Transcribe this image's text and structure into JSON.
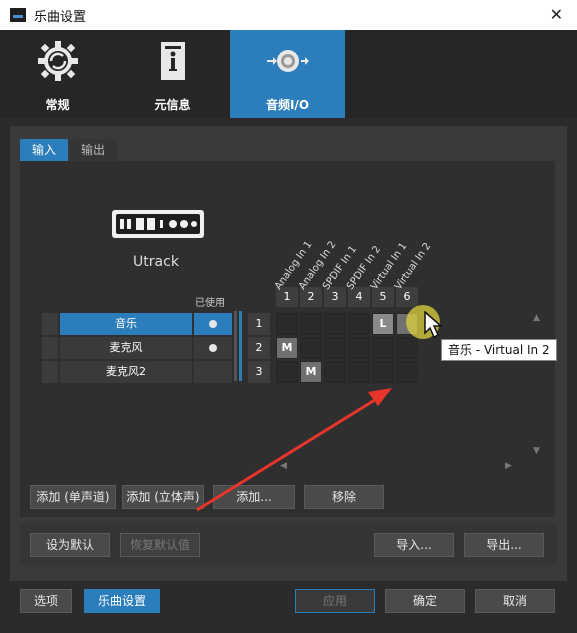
{
  "window": {
    "title": "乐曲设置",
    "close_glyph": "✕"
  },
  "categories": [
    {
      "label": "常规",
      "icon": "gear-refresh-icon",
      "active": false
    },
    {
      "label": "元信息",
      "icon": "info-document-icon",
      "active": false
    },
    {
      "label": "音频I/O",
      "icon": "speaker-io-icon",
      "active": true
    }
  ],
  "subtabs": [
    {
      "label": "输入",
      "active": true
    },
    {
      "label": "输出",
      "active": false
    }
  ],
  "device": {
    "name": "Utrack",
    "icon": "audio-interface-icon"
  },
  "channels": {
    "used_header": "已使用",
    "rows": [
      {
        "num": "1",
        "name": "音乐",
        "used": true,
        "selected": true
      },
      {
        "num": "2",
        "name": "麦克风",
        "used": true,
        "selected": false
      },
      {
        "num": "3",
        "name": "麦克风2",
        "used": false,
        "selected": false
      }
    ]
  },
  "inputs": {
    "numbers": [
      "1",
      "2",
      "3",
      "4",
      "5",
      "6"
    ],
    "labels": [
      "Analog In 1",
      "Analog In 2",
      "SPDIF In 1",
      "SPDIF In 2",
      "Virtual In 1",
      "Virtual In 2"
    ]
  },
  "matrix": {
    "assignments": [
      {
        "row": 0,
        "col": 4,
        "label": "L"
      },
      {
        "row": 0,
        "col": 5,
        "label": ""
      },
      {
        "row": 1,
        "col": 0,
        "label": "M"
      },
      {
        "row": 2,
        "col": 1,
        "label": "M"
      }
    ]
  },
  "tooltip": "音乐 - Virtual In 2",
  "scroll": {
    "up": "▲",
    "down": "▼",
    "left": "◀",
    "right": "▶"
  },
  "buttons": {
    "add_mono": "添加 (单声道)",
    "add_stereo": "添加 (立体声)",
    "add_more": "添加...",
    "remove": "移除",
    "set_default": "设为默认",
    "restore_default": "恢复默认值",
    "import": "导入...",
    "export": "导出...",
    "options": "选项",
    "song_settings": "乐曲设置",
    "apply": "应用",
    "ok": "确定",
    "cancel": "取消"
  },
  "colors": {
    "accent": "#2b7dbc",
    "annotation_arrow": "#e8352b"
  }
}
